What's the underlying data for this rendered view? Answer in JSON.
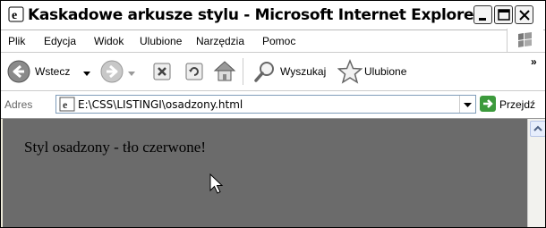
{
  "window": {
    "title": "Kaskadowe arkusze stylu - Microsoft Internet Explorer",
    "buttons": [
      "minimize",
      "maximize",
      "close"
    ]
  },
  "menubar": {
    "items": [
      "Plik",
      "Edycja",
      "Widok",
      "Ulubione",
      "Narzędzia",
      "Pomoc"
    ]
  },
  "toolbar": {
    "back_label": "Wstecz",
    "search_label": "Wyszukaj",
    "favorites_label": "Ulubione",
    "overflow_label": "»"
  },
  "address_bar": {
    "label": "Adres",
    "url": "E:\\CSS\\LISTINGI\\osadzony.html",
    "go_label": "Przejdź"
  },
  "content": {
    "text": "Styl osadzony - tło czerwone!",
    "background": "#6b6b6b"
  }
}
